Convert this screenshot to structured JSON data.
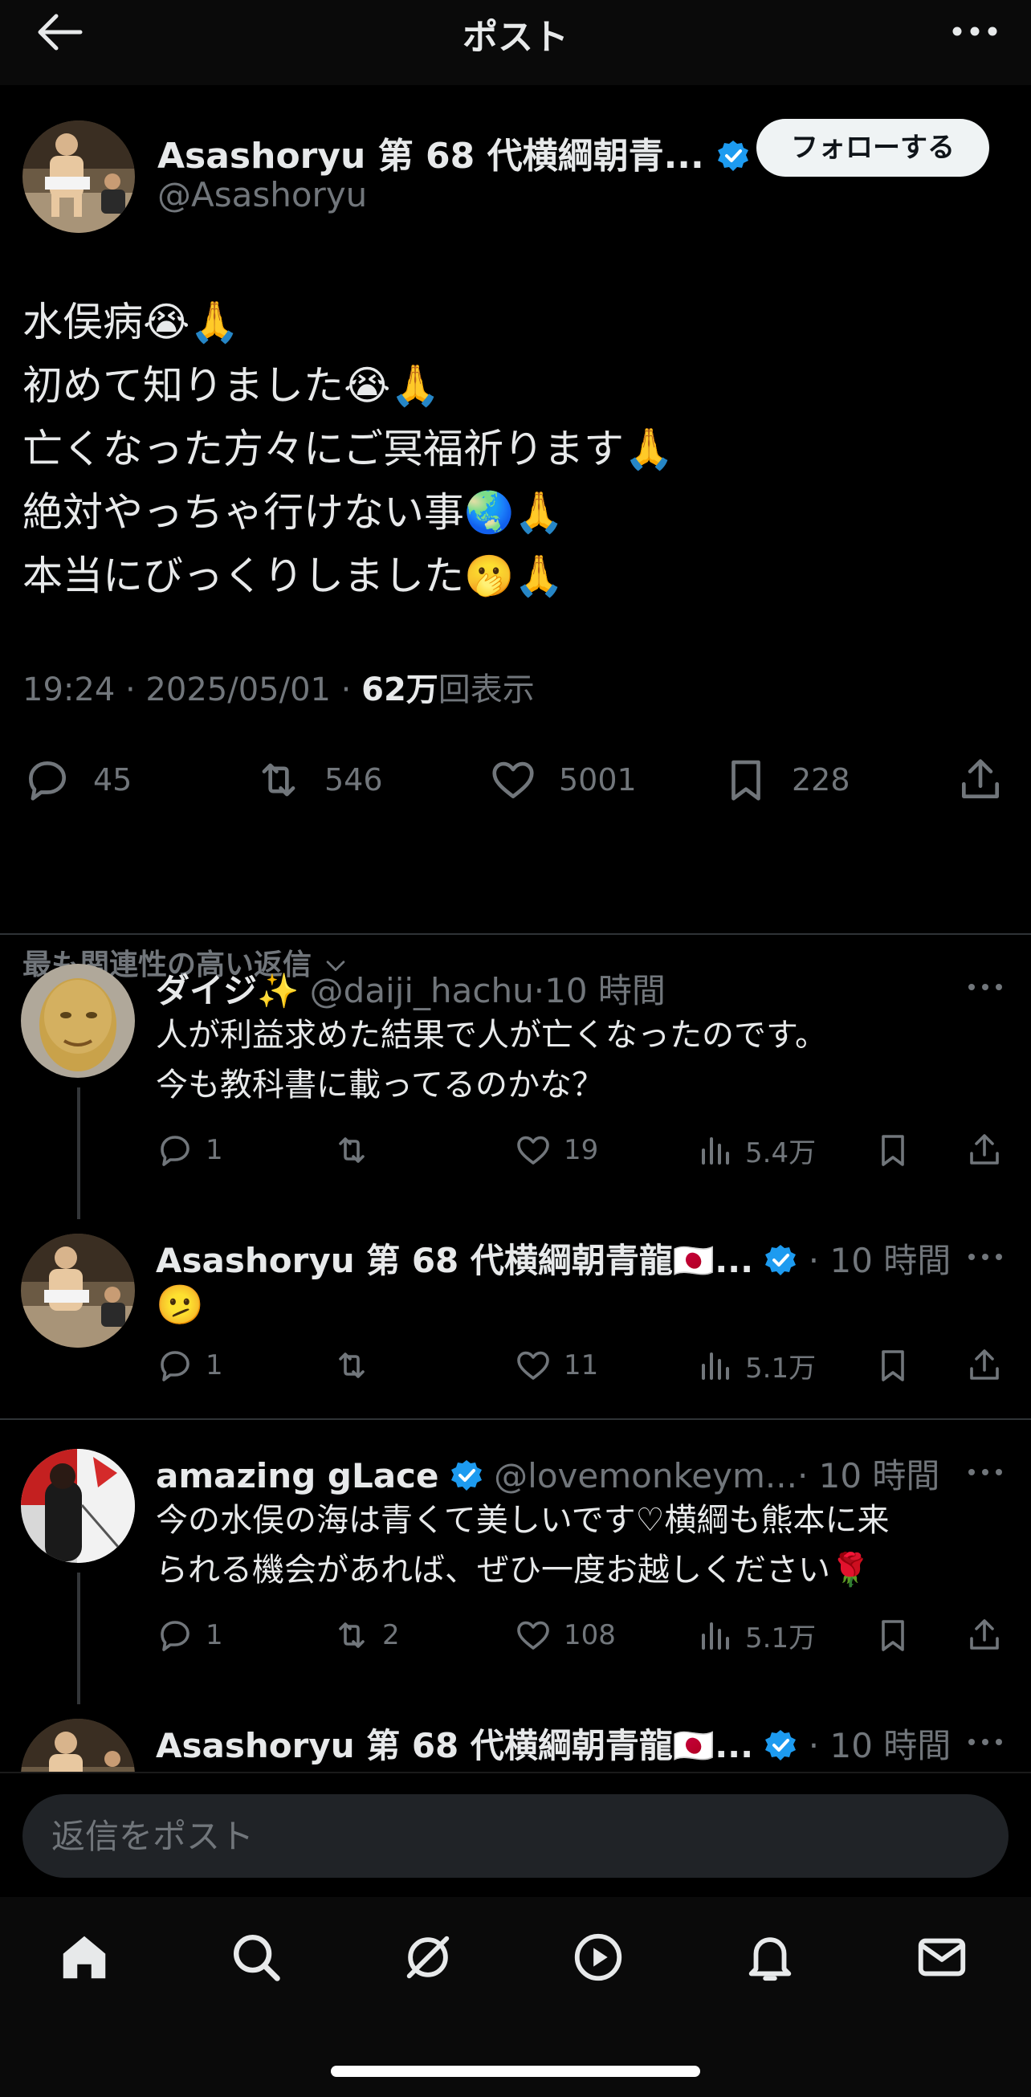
{
  "header": {
    "title": "ポスト"
  },
  "post": {
    "author_name": "Asashoryu 第 68 代横綱朝青...",
    "handle": "@Asashoryu",
    "follow_label": "フォローする",
    "text": "水俣病😭🙏\n初めて知りました😭🙏\n亡くなった方々にご冥福祈ります🙏\n絶対やっちゃ行けない事🌏🙏\n本当にびっくりしました🫢🙏",
    "timestamp": "19:24 · 2025/05/01 · ",
    "views_count": "62万",
    "views_label": "回表示",
    "stats": {
      "replies": "45",
      "reposts": "546",
      "likes": "5001",
      "bookmarks": "228"
    }
  },
  "sort_label": "最も関連性の高い返信",
  "replies": [
    {
      "name": "ダイジ✨",
      "handle": "@daiji_hachu",
      "time": "·10 時間",
      "text": "人が利益求めた結果で人が亡くなったのです。\n今も教科書に載ってるのかな？",
      "replies": "1",
      "reposts": "",
      "likes": "19",
      "views": "5.4万"
    },
    {
      "name": "Asashoryu 第 68 代横綱朝青龍🇯🇵...",
      "handle": "",
      "time": "· 10 時間",
      "text": "🫤",
      "replies": "1",
      "reposts": "",
      "likes": "11",
      "views": "5.1万"
    },
    {
      "name": "amazing gLace",
      "handle": "@lovemonkeym...",
      "time": "· 10 時間",
      "text": "今の水俣の海は青くて美しいです♡横綱も熊本に来\nられる機会があれば、ぜひ一度お越しください🌹",
      "replies": "1",
      "reposts": "2",
      "likes": "108",
      "views": "5.1万"
    },
    {
      "name": "Asashoryu 第 68 代横綱朝青龍🇯🇵...",
      "handle": "",
      "time": "· 10 時間",
      "text": "",
      "replies": "",
      "reposts": "",
      "likes": "",
      "views": ""
    }
  ],
  "reply_bar": {
    "placeholder": "返信をポスト"
  },
  "colors": {
    "background": "#000000",
    "text": "#e7e9ea",
    "muted": "#71767b",
    "verified": "#1d9bf0",
    "divider": "#2f3336"
  }
}
